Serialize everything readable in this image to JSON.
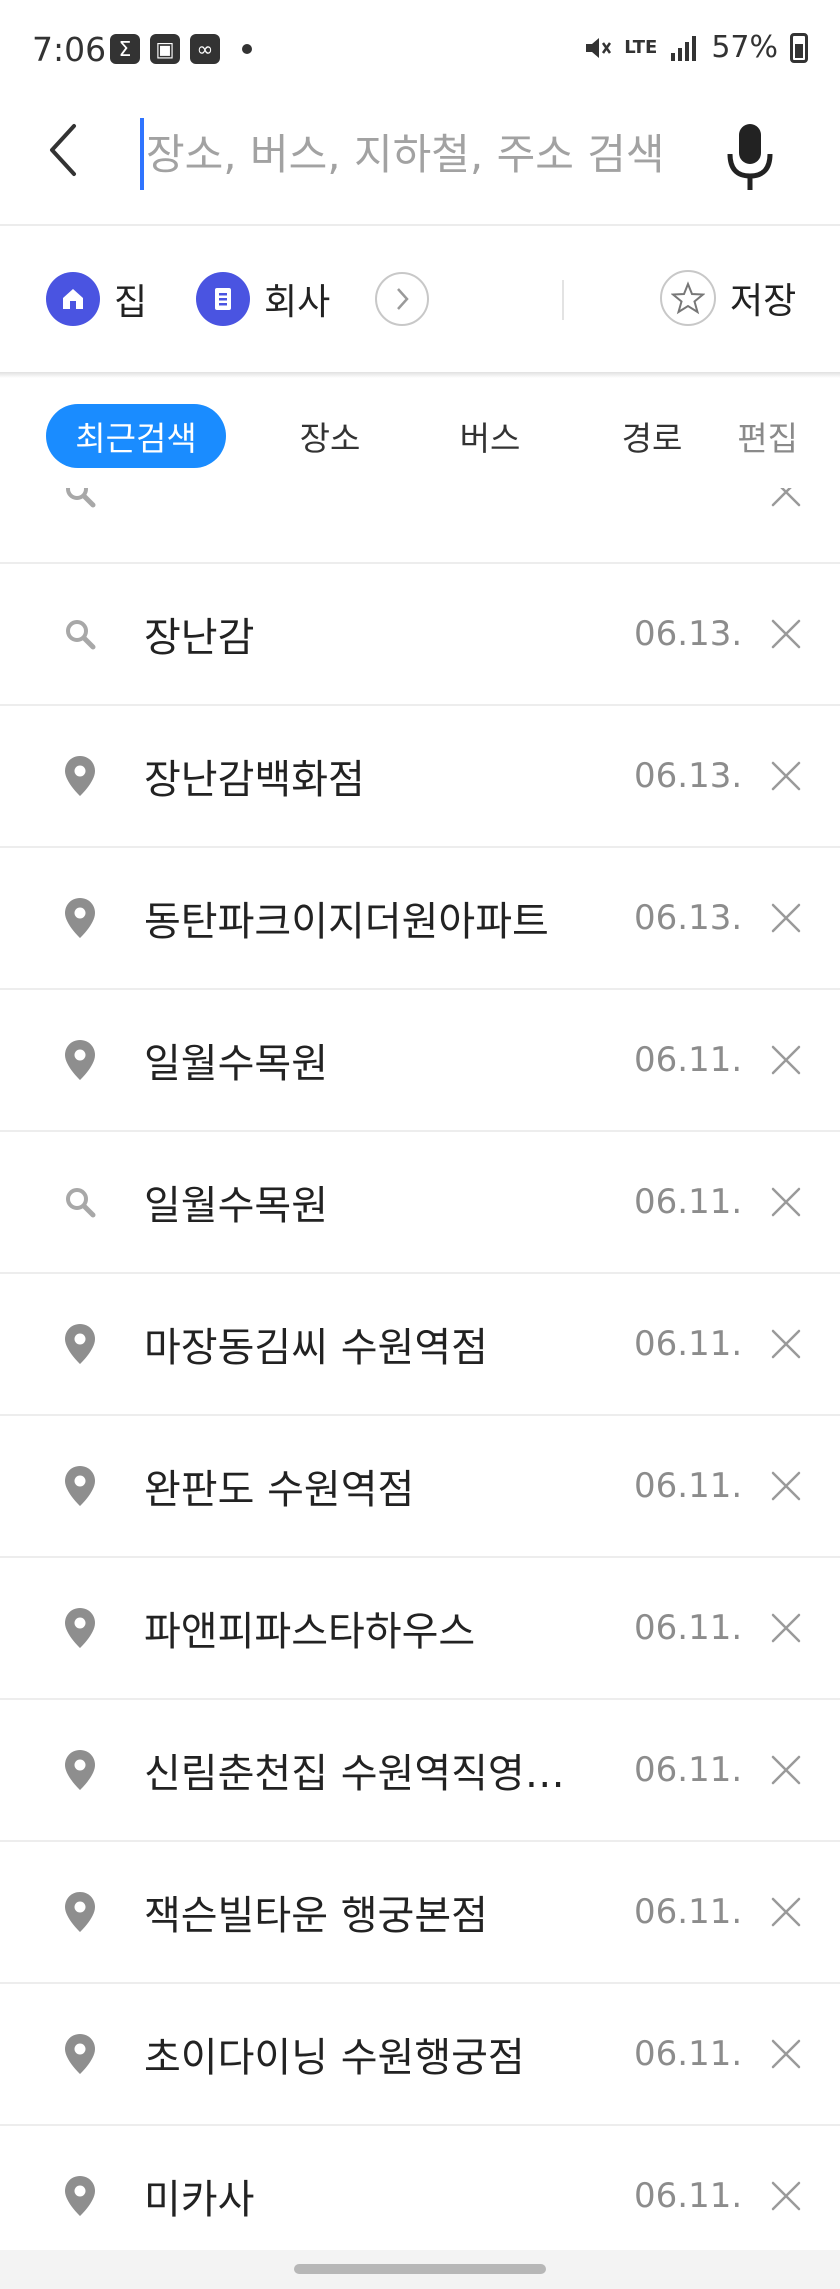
{
  "status": {
    "time": "7:06",
    "network": "LTE",
    "battery": "57%"
  },
  "search": {
    "placeholder": "장소, 버스, 지하철, 주소 검색"
  },
  "shortcuts": {
    "home_label": "집",
    "work_label": "회사",
    "save_label": "저장"
  },
  "tabs": [
    {
      "label": "최근검색",
      "active": true
    },
    {
      "label": "장소"
    },
    {
      "label": "버스"
    },
    {
      "label": "경로"
    }
  ],
  "edit_label": "편집",
  "recent": [
    {
      "icon": "search-icon",
      "title": "",
      "date": ""
    },
    {
      "icon": "search-icon",
      "title": "장난감",
      "date": "06.13."
    },
    {
      "icon": "place-pin-icon",
      "title": "장난감백화점",
      "date": "06.13."
    },
    {
      "icon": "place-pin-icon",
      "title": "동탄파크이지더원아파트",
      "date": "06.13."
    },
    {
      "icon": "place-pin-icon",
      "title": "일월수목원",
      "date": "06.11."
    },
    {
      "icon": "search-icon",
      "title": "일월수목원",
      "date": "06.11."
    },
    {
      "icon": "place-pin-icon",
      "title": "마장동김씨 수원역점",
      "date": "06.11."
    },
    {
      "icon": "place-pin-icon",
      "title": "완판도 수원역점",
      "date": "06.11."
    },
    {
      "icon": "place-pin-icon",
      "title": "파앤피파스타하우스",
      "date": "06.11."
    },
    {
      "icon": "place-pin-icon",
      "title": "신림춘천집 수원역직영…",
      "date": "06.11."
    },
    {
      "icon": "place-pin-icon",
      "title": "잭슨빌타운 행궁본점",
      "date": "06.11."
    },
    {
      "icon": "place-pin-icon",
      "title": "초이다이닝 수원행궁점",
      "date": "06.11."
    },
    {
      "icon": "place-pin-icon",
      "title": "미카사",
      "date": "06.11."
    }
  ],
  "colors": {
    "accent": "#1a8cff",
    "shortcut": "#4a54e1",
    "date": "#8c8c8c"
  }
}
